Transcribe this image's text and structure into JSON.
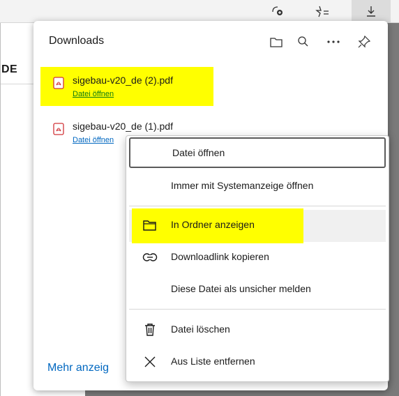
{
  "downloads_panel": {
    "title": "Downloads",
    "more_link": "Mehr anzeig",
    "items": [
      {
        "filename": "sigebau-v20_de (2).pdf",
        "open_label": "Datei öffnen"
      },
      {
        "filename": "sigebau-v20_de (1).pdf",
        "open_label": "Datei öffnen"
      }
    ]
  },
  "page": {
    "text": "DE"
  },
  "context_menu": {
    "items": [
      {
        "label": "Datei öffnen"
      },
      {
        "label": "Immer mit Systemanzeige öffnen"
      },
      {
        "label": "In Ordner anzeigen",
        "icon": "folder-icon"
      },
      {
        "label": "Downloadlink kopieren",
        "icon": "link-icon"
      },
      {
        "label": "Diese Datei als unsicher melden"
      },
      {
        "label": "Datei löschen",
        "icon": "trash-icon"
      },
      {
        "label": "Aus Liste entfernen",
        "icon": "close-icon"
      }
    ]
  },
  "colors": {
    "highlight": "#ffff00",
    "link_green": "#107c10",
    "link_blue": "#0067c0"
  }
}
